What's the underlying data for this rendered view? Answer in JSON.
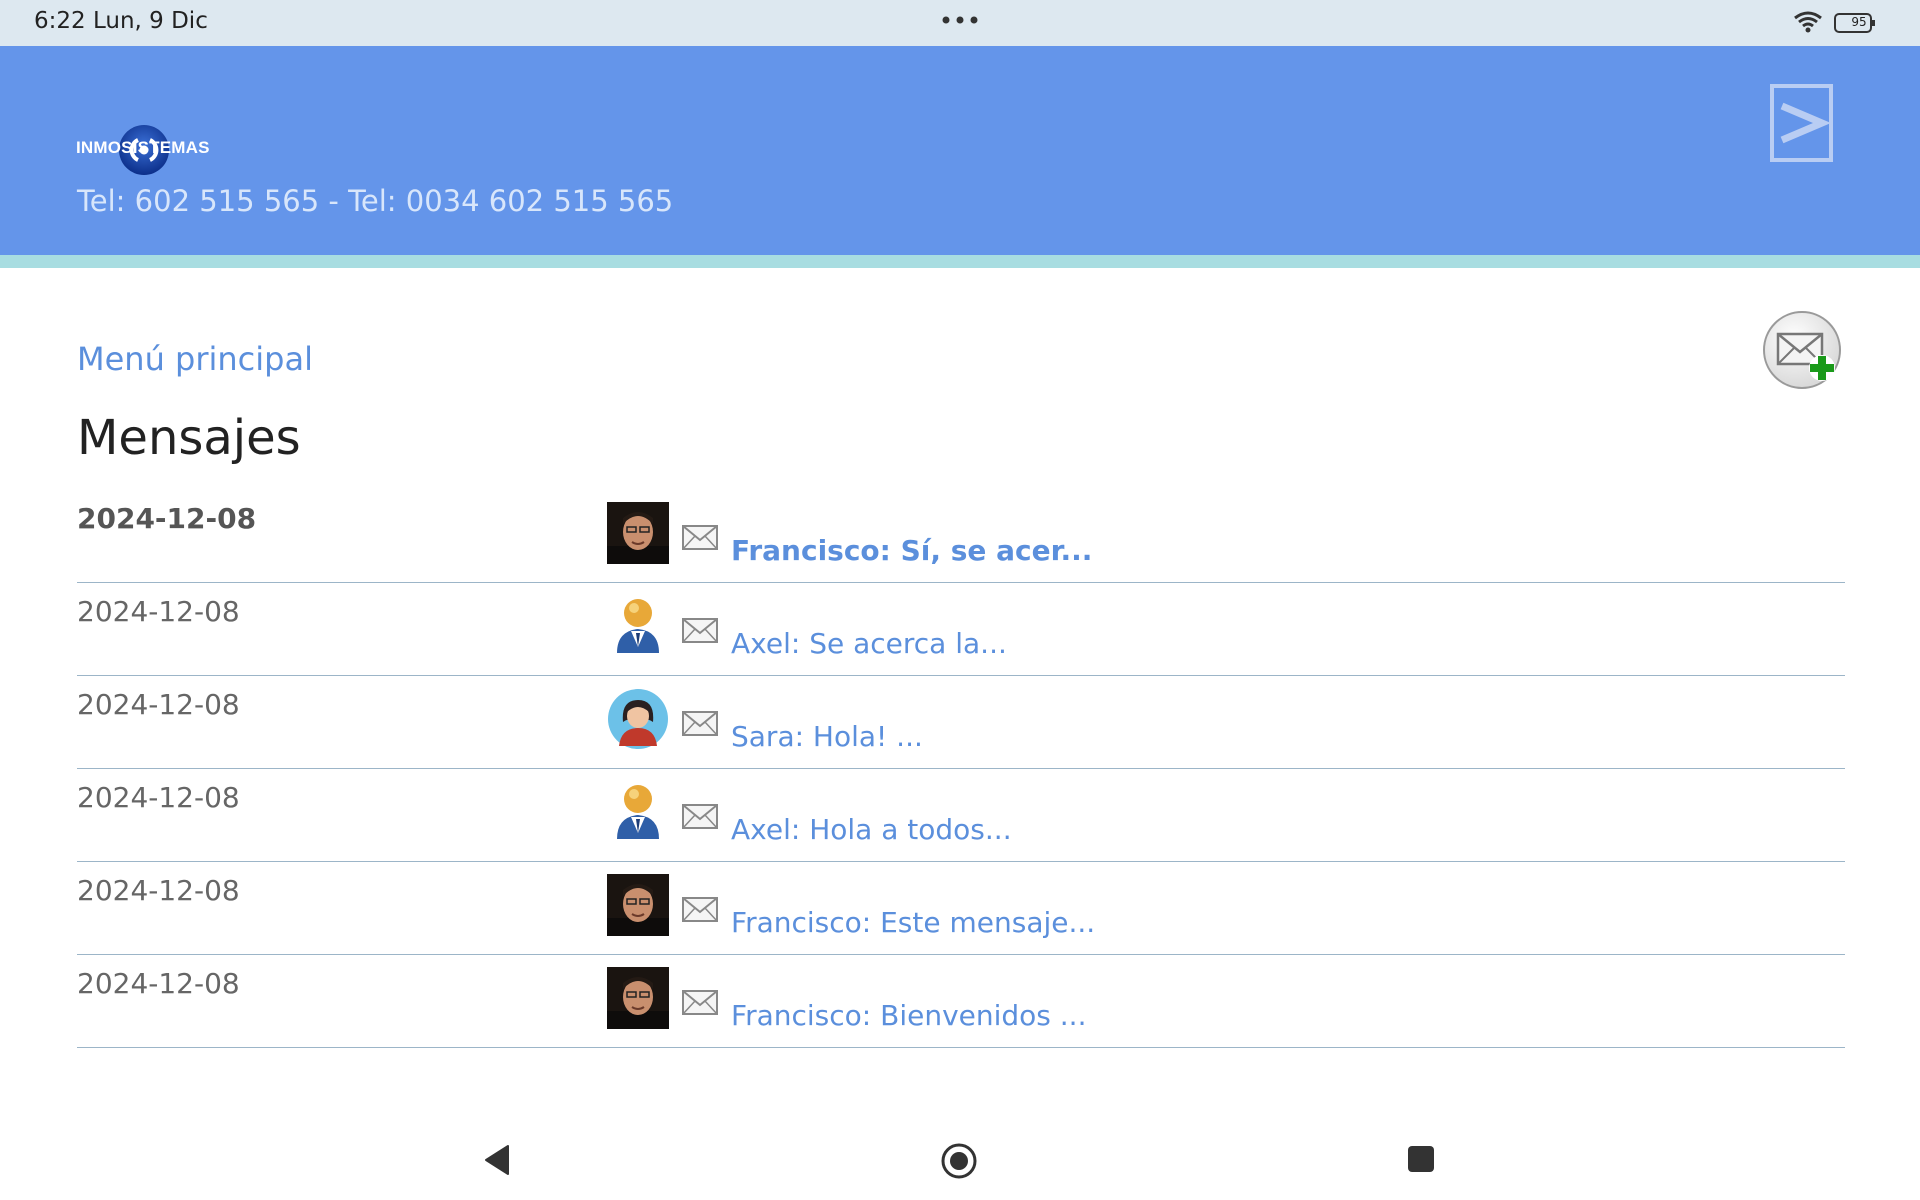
{
  "status": {
    "time": "6:22  Lun, 9 Dic",
    "battery": "95"
  },
  "header": {
    "brand": "INMOSISTEMAS",
    "phone": "Tel: 602 515 565 - Tel: 0034 602 515 565"
  },
  "nav": {
    "menu_label": "Menú principal"
  },
  "page": {
    "title": "Mensajes"
  },
  "messages": [
    {
      "date": "2024-12-08",
      "text": "Francisco: Sí, se acer...",
      "avatar": "photo-man",
      "unread": true
    },
    {
      "date": "2024-12-08",
      "text": "Axel: Se acerca la...",
      "avatar": "generic-user",
      "unread": false
    },
    {
      "date": "2024-12-08",
      "text": "Sara: Hola! ...",
      "avatar": "woman",
      "unread": false
    },
    {
      "date": "2024-12-08",
      "text": "Axel: Hola a todos...",
      "avatar": "generic-user",
      "unread": false
    },
    {
      "date": "2024-12-08",
      "text": "Francisco: Este mensaje...",
      "avatar": "photo-man",
      "unread": false
    },
    {
      "date": "2024-12-08",
      "text": "Francisco: Bienvenidos ...",
      "avatar": "photo-man",
      "unread": false
    }
  ],
  "colors": {
    "header": "#6495ea",
    "stripe": "#a8dde1",
    "link": "#5b8fdc"
  },
  "icons": {
    "play": "play-icon",
    "compose": "compose-mail-icon",
    "envelope": "envelope-icon"
  }
}
